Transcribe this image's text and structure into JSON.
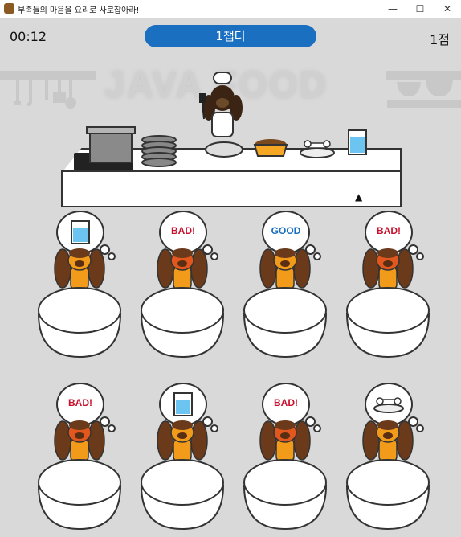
{
  "window": {
    "title": "부족들의 마음을 요리로 사로잡아라!",
    "minimize": "—",
    "maximize": "☐",
    "close": "✕"
  },
  "hud": {
    "timer": "00:12",
    "chapter": "1챕터",
    "score": "1점"
  },
  "scene": {
    "logo": "JAVA FOOD"
  },
  "kitchen": {
    "items": [
      {
        "name": "pot",
        "icon": "pot-icon"
      },
      {
        "name": "plates",
        "icon": "plates-icon"
      },
      {
        "name": "empty-plate",
        "icon": "plate-icon"
      },
      {
        "name": "dog-food-bowl",
        "icon": "kibble-bowl-icon"
      },
      {
        "name": "bone-plate",
        "icon": "bone-icon"
      },
      {
        "name": "water-glass",
        "icon": "water-glass-icon"
      }
    ]
  },
  "customers": [
    {
      "request": "water",
      "label": ""
    },
    {
      "request": "bad",
      "label": "BAD!"
    },
    {
      "request": "good",
      "label": "GOOD"
    },
    {
      "request": "bad",
      "label": "BAD!"
    },
    {
      "request": "bad",
      "label": "BAD!"
    },
    {
      "request": "water",
      "label": ""
    },
    {
      "request": "bad",
      "label": "BAD!"
    },
    {
      "request": "bone",
      "label": ""
    }
  ],
  "colors": {
    "chapter_bg": "#1a6fc0",
    "bad_text": "#c8102e",
    "good_text": "#1a6fc0",
    "dog_brown": "#6b3a1b",
    "dog_orange": "#f29a1a"
  }
}
